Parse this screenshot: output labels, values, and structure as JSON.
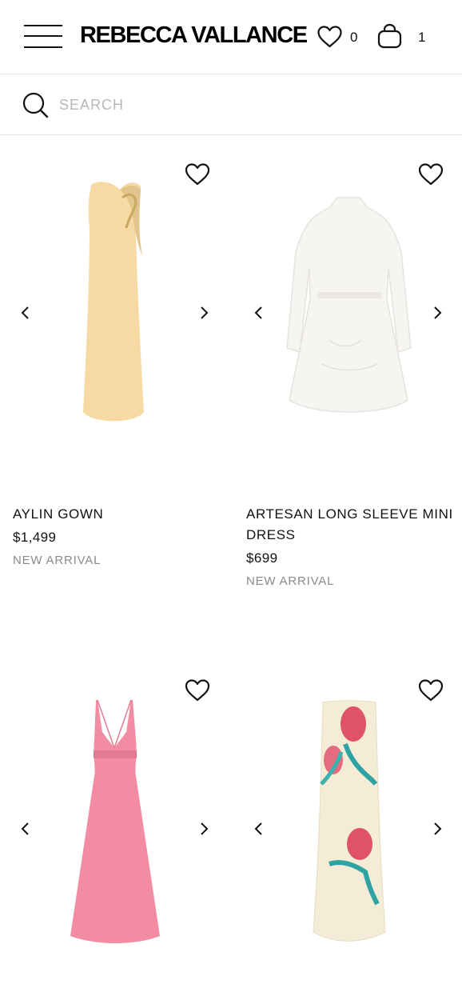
{
  "header": {
    "logo": "REBECCA VALLANCE",
    "wishlist_count": "0",
    "bag_count": "1"
  },
  "search": {
    "placeholder": "SEARCH"
  },
  "products": [
    {
      "name": "AYLIN GOWN",
      "price": "$1,499",
      "badge": "NEW ARRIVAL",
      "color": "#f7d9a4"
    },
    {
      "name": "ARTESAN LONG SLEEVE MINI DRESS",
      "price": "$699",
      "badge": "NEW ARRIVAL",
      "color": "#f7f5f2"
    },
    {
      "name": "",
      "price": "",
      "badge": "",
      "color": "#f28ca3"
    },
    {
      "name": "",
      "price": "",
      "badge": "",
      "color": "#f5ecd7"
    }
  ]
}
